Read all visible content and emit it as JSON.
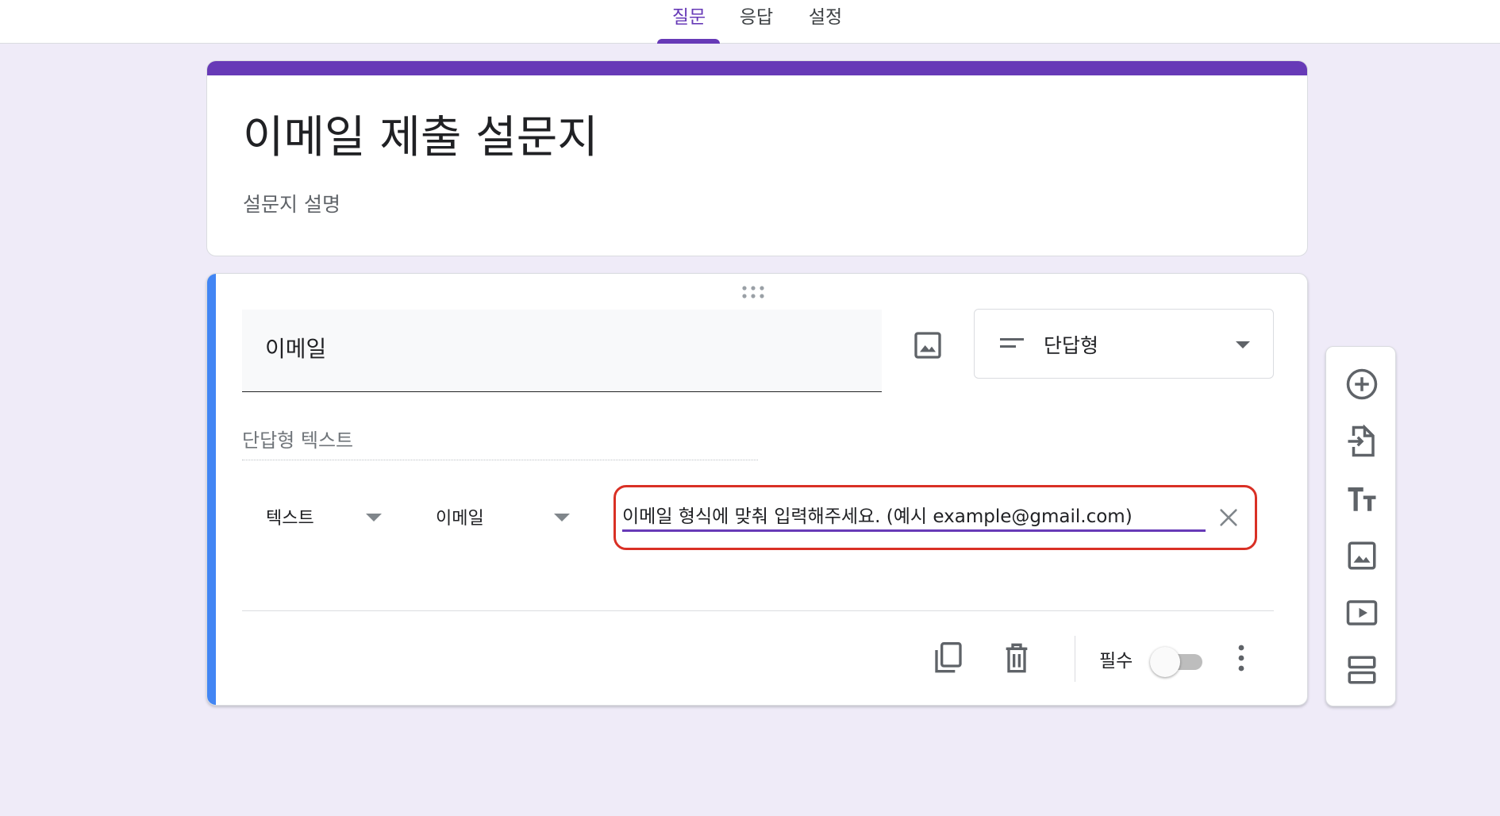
{
  "tabs": [
    {
      "label": "질문",
      "active": true
    },
    {
      "label": "응답",
      "active": false
    },
    {
      "label": "설정",
      "active": false
    }
  ],
  "form": {
    "title": "이메일 제출 설문지",
    "description": "설문지 설명"
  },
  "question": {
    "title": "이메일",
    "type_label": "단답형",
    "answer_placeholder": "단답형 텍스트",
    "validation": {
      "category": "텍스트",
      "condition": "이메일",
      "error_text": "이메일 형식에 맞춰 입력해주세요. (예시 example@gmail.com)"
    },
    "required_label": "필수",
    "required_on": false
  },
  "icons": {
    "drag": "drag-handle-icon",
    "image": "image-icon",
    "short_answer": "short-text-icon",
    "close": "close-icon",
    "copy": "copy-icon",
    "delete": "trash-icon",
    "more": "more-vert-icon",
    "add": "add-circle-icon",
    "import": "import-icon",
    "title": "title-text-icon",
    "add_image": "add-image-icon",
    "video": "video-icon",
    "section": "section-icon"
  },
  "colors": {
    "accent": "#673ab7",
    "active_question": "#4285f4",
    "error": "#d93025",
    "background": "#efebf8"
  }
}
